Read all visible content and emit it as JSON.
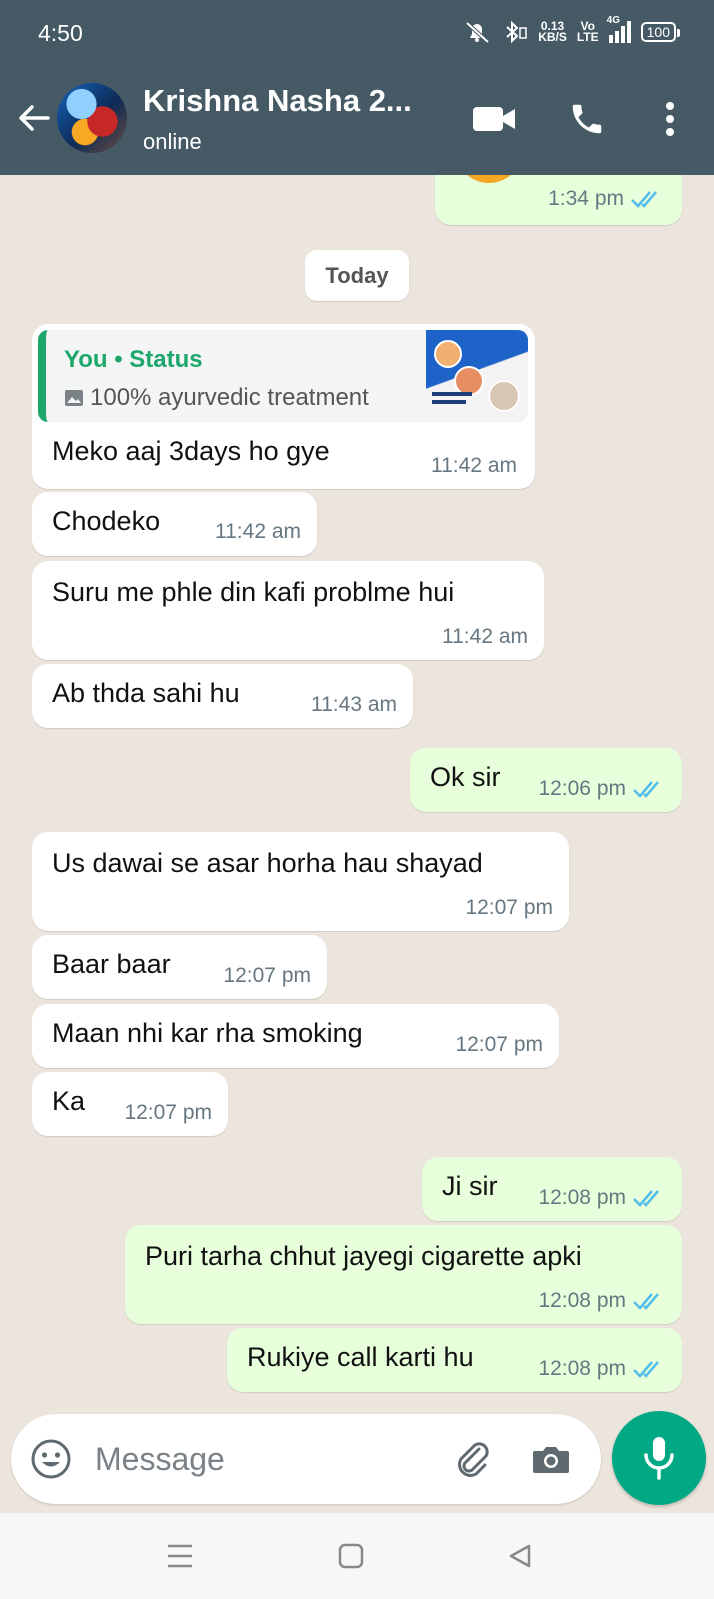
{
  "status_bar": {
    "time": "4:50",
    "net_speed_top": "0.13",
    "net_speed_bottom": "KB/S",
    "volte_top": "Vo",
    "volte_bottom": "LTE",
    "network": "4G",
    "battery": "100",
    "icons": [
      "mute-icon",
      "bluetooth-icon",
      "signal-icon",
      "battery-icon"
    ]
  },
  "header": {
    "contact_name": "Krishna Nasha 2...",
    "contact_status": "online",
    "icons": [
      "back-arrow-icon",
      "avatar",
      "video-call-icon",
      "voice-call-icon",
      "more-vert-icon"
    ]
  },
  "chat": {
    "date_chip": "Today",
    "messages": [
      {
        "dir": "out",
        "text": "",
        "time": "1:34 pm",
        "read": true
      },
      {
        "dir": "in",
        "quote_author": "You • Status",
        "quote_text": "100% ayurvedic treatment",
        "text": "Meko aaj 3days ho gye",
        "time": "11:42 am"
      },
      {
        "dir": "in",
        "text": "Chodeko",
        "time": "11:42 am"
      },
      {
        "dir": "in",
        "text": "Suru me phle din kafi problme hui",
        "time": "11:42 am"
      },
      {
        "dir": "in",
        "text": "Ab thda sahi hu",
        "time": "11:43 am"
      },
      {
        "dir": "out",
        "text": "Ok sir",
        "time": "12:06 pm",
        "read": true
      },
      {
        "dir": "in",
        "text": "Us dawai se asar horha hau shayad",
        "time": "12:07 pm"
      },
      {
        "dir": "in",
        "text": "Baar baar",
        "time": "12:07 pm"
      },
      {
        "dir": "in",
        "text": "Maan nhi kar rha smoking",
        "time": "12:07 pm"
      },
      {
        "dir": "in",
        "text": "Ka",
        "time": "12:07 pm"
      },
      {
        "dir": "out",
        "text": "Ji sir",
        "time": "12:08 pm",
        "read": true
      },
      {
        "dir": "out",
        "text": "Puri tarha chhut jayegi cigarette apki",
        "time": "12:08 pm",
        "read": true
      },
      {
        "dir": "out",
        "text": "Rukiye call karti hu",
        "time": "12:08 pm",
        "read": true
      }
    ]
  },
  "input_bar": {
    "placeholder": "Message",
    "icons": [
      "emoji-icon",
      "attach-icon",
      "camera-icon",
      "mic-icon"
    ]
  },
  "nav_bar": {
    "icons": [
      "menu-icon",
      "home-icon",
      "back-icon"
    ]
  },
  "colors": {
    "app_bar": "#455A64",
    "chat_bg": "#ECE5DD",
    "outgoing_bubble": "#E7FFDB",
    "incoming_bubble": "#FFFFFF",
    "read_tick": "#53BDEB",
    "accent": "#00A884"
  }
}
